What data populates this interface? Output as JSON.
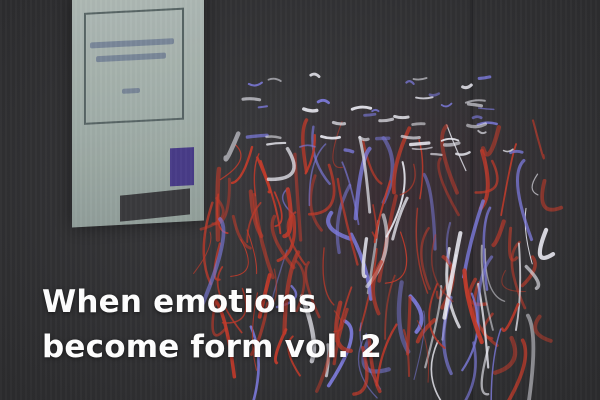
{
  "caption": {
    "line1": "When emotions",
    "line2": "become form vol. 2"
  },
  "colors": {
    "background": "#2f2f31",
    "stroke_red": "#c23a2a",
    "stroke_blue": "#7a78d8",
    "stroke_white": "#e8e8f0",
    "caption_text": "#ffffff"
  }
}
